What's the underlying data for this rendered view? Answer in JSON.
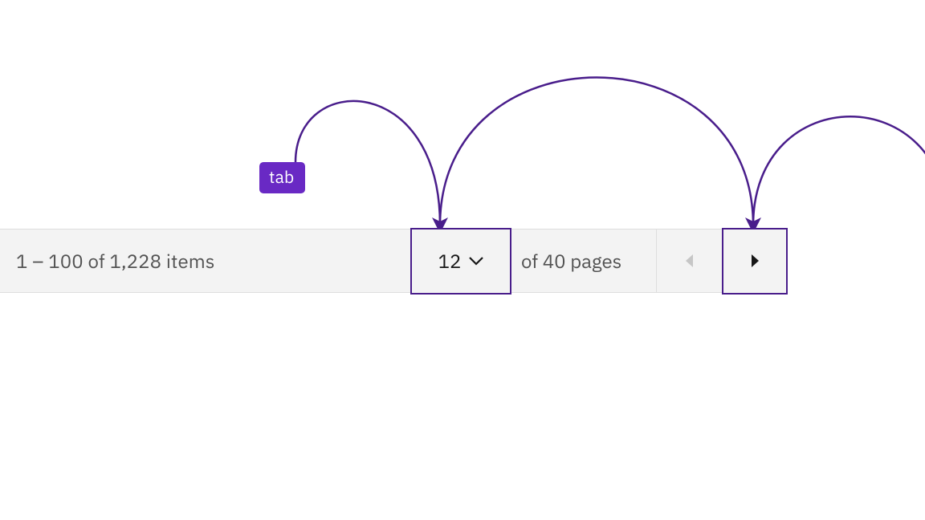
{
  "colors": {
    "accent": "#491d8b",
    "badge_bg": "#6929c4",
    "bar_bg": "#f3f3f3",
    "text_secondary": "#525252",
    "text_primary": "#161616",
    "border_light": "#dedede",
    "disabled_icon": "#c6c6c6"
  },
  "badge": {
    "label": "tab"
  },
  "pagination": {
    "items_text": "1 – 100 of 1,228 items",
    "current_page": "12",
    "pages_text": "of 40 pages"
  }
}
